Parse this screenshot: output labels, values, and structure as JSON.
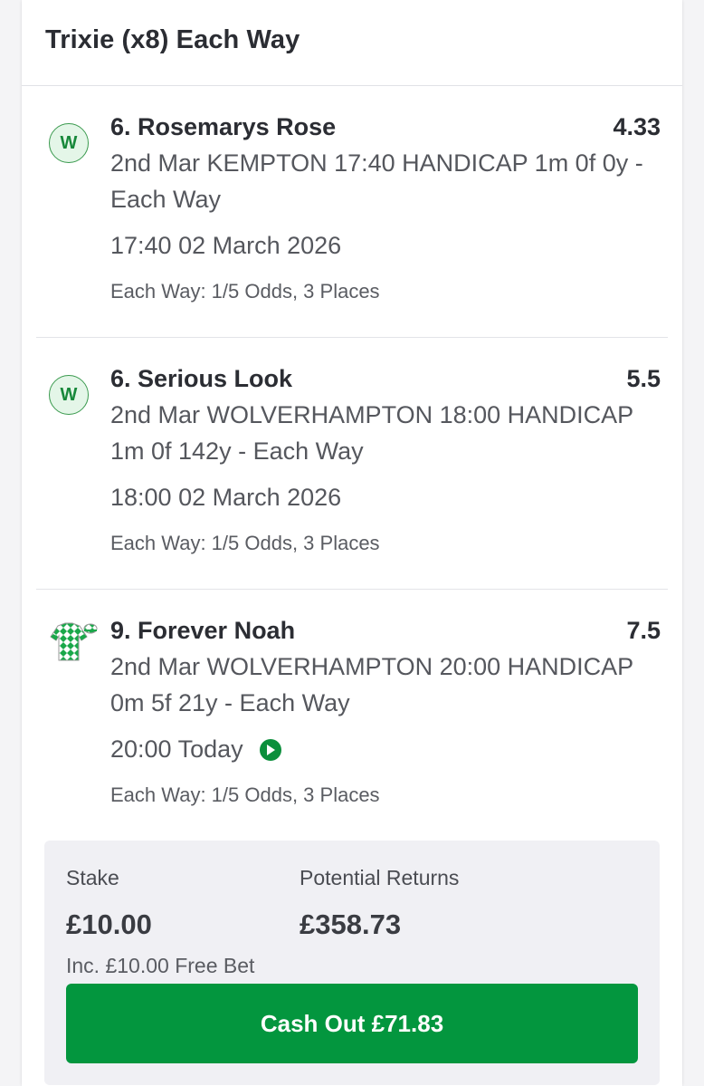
{
  "bet_title": "Trixie (x8) Each Way",
  "colors": {
    "accent_green": "#03963e",
    "badge_bg": "#e4f6e8",
    "badge_text": "#17883a"
  },
  "legs": [
    {
      "badge": "W",
      "icon": "w-badge-icon",
      "selection": "6. Rosemarys Rose",
      "odds": "4.33",
      "market": "2nd Mar KEMPTON 17:40 HANDICAP 1m 0f 0y - Each Way",
      "time": "17:40 02 March 2026",
      "each_way": "Each Way: 1/5 Odds, 3 Places"
    },
    {
      "badge": "W",
      "icon": "w-badge-icon",
      "selection": "6. Serious Look",
      "odds": "5.5",
      "market": "2nd Mar WOLVERHAMPTON 18:00 HANDICAP 1m 0f 142y - Each Way",
      "time": "18:00 02 March 2026",
      "each_way": "Each Way: 1/5 Odds, 3 Places"
    },
    {
      "icon": "jockey-silks-icon",
      "selection": "9. Forever Noah",
      "odds": "7.5",
      "market": "2nd Mar WOLVERHAMPTON 20:00 HANDICAP 0m 5f 21y - Each Way",
      "time": "20:00 Today",
      "live_icon": "play-circle-icon",
      "each_way": "Each Way: 1/5 Odds, 3 Places"
    }
  ],
  "stake": {
    "label": "Stake",
    "value": "£10.00",
    "note": "Inc. £10.00 Free Bet"
  },
  "returns": {
    "label": "Potential Returns",
    "value": "£358.73"
  },
  "cashout_label": "Cash Out £71.83"
}
